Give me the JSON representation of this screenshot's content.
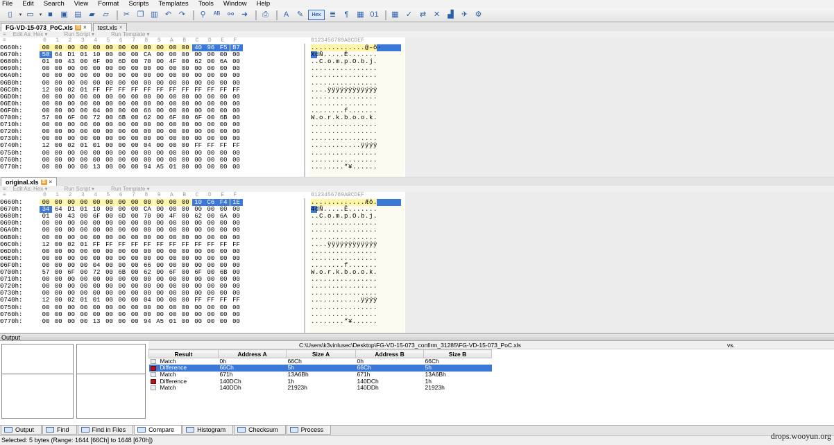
{
  "menu": [
    "File",
    "Edit",
    "Search",
    "View",
    "Format",
    "Scripts",
    "Templates",
    "Tools",
    "Window",
    "Help"
  ],
  "toolbar_icons": [
    {
      "name": "new-file-icon",
      "glyph": "▯"
    },
    {
      "name": "dropdown-icon",
      "glyph": "▾"
    },
    {
      "name": "open-file-icon",
      "glyph": "▭"
    },
    {
      "name": "dropdown-icon",
      "glyph": "▾"
    },
    {
      "name": "save-icon",
      "glyph": "■"
    },
    {
      "name": "save-as-icon",
      "glyph": "▣"
    },
    {
      "name": "save-all-icon",
      "glyph": "▤"
    },
    {
      "name": "open-folder-icon",
      "glyph": "▰"
    },
    {
      "name": "close-folder-icon",
      "glyph": "▱"
    },
    {
      "name": "sep"
    },
    {
      "name": "cut-icon",
      "glyph": "✂"
    },
    {
      "name": "copy-icon",
      "glyph": "❐"
    },
    {
      "name": "paste-icon",
      "glyph": "▥"
    },
    {
      "name": "undo-icon",
      "glyph": "↶"
    },
    {
      "name": "redo-icon",
      "glyph": "↷"
    },
    {
      "name": "sep"
    },
    {
      "name": "find-icon",
      "glyph": "⚲"
    },
    {
      "name": "replace-icon",
      "glyph": "ᴬᴮ"
    },
    {
      "name": "find-in-files-icon",
      "glyph": "⚯"
    },
    {
      "name": "goto-icon",
      "glyph": "➜"
    },
    {
      "name": "sep"
    },
    {
      "name": "print-icon",
      "glyph": "⎙"
    },
    {
      "name": "sep"
    },
    {
      "name": "font-icon",
      "glyph": "A"
    },
    {
      "name": "highlight-icon",
      "glyph": "✎"
    },
    {
      "name": "hex-view-icon",
      "glyph": "Hex",
      "hex": true
    },
    {
      "name": "text-view-icon",
      "glyph": "≣"
    },
    {
      "name": "paragraph-icon",
      "glyph": "¶"
    },
    {
      "name": "columns-icon",
      "glyph": "▦"
    },
    {
      "name": "binary-icon",
      "glyph": "01"
    },
    {
      "name": "sep"
    },
    {
      "name": "calculator-icon",
      "glyph": "▦"
    },
    {
      "name": "inspector-icon",
      "glyph": "✓"
    },
    {
      "name": "compare-icon",
      "glyph": "⇄"
    },
    {
      "name": "tools-icon",
      "glyph": "✕"
    },
    {
      "name": "histogram-icon",
      "glyph": "▟"
    },
    {
      "name": "template-icon",
      "glyph": "✈"
    },
    {
      "name": "checksum-icon",
      "glyph": "⚙"
    }
  ],
  "tabs_top": [
    {
      "label": "FG-VD-15-073_PoC.xls",
      "active": true
    },
    {
      "label": "test.xls",
      "active": false
    }
  ],
  "tabs_bottom_file": [
    {
      "label": "original.xls",
      "active": true
    }
  ],
  "subbar": {
    "edit_as": "Edit As: Hex ▾",
    "run_script": "Run Script ▾",
    "run_template": "Run Template ▾"
  },
  "hex_header": {
    "prefix": "≡",
    "cols": [
      "0",
      "1",
      "2",
      "3",
      "4",
      "5",
      "6",
      "7",
      "8",
      "9",
      "A",
      "B",
      "C",
      "D",
      "E",
      "F"
    ],
    "ascii": "0123456789ABCDEF"
  },
  "pane1": {
    "rows": [
      {
        "addr": "0660h:",
        "bytes": [
          "00",
          "00",
          "00",
          "00",
          "00",
          "00",
          "00",
          "00",
          "00",
          "00",
          "00",
          "00",
          "40",
          "96",
          "F5",
          "B7"
        ],
        "ascii": ".............@–õ·"
      },
      {
        "addr": "0670h:",
        "bytes": [
          "58",
          "64",
          "D1",
          "01",
          "10",
          "00",
          "00",
          "00",
          "CA",
          "00",
          "00",
          "00",
          "00",
          "00",
          "00",
          "00"
        ],
        "ascii": "XdÑ.....Ê......."
      },
      {
        "addr": "0680h:",
        "bytes": [
          "01",
          "00",
          "43",
          "00",
          "6F",
          "00",
          "6D",
          "00",
          "70",
          "00",
          "4F",
          "00",
          "62",
          "00",
          "6A",
          "00"
        ],
        "ascii": "..C.o.m.p.O.b.j."
      },
      {
        "addr": "0690h:",
        "bytes": [
          "00",
          "00",
          "00",
          "00",
          "00",
          "00",
          "00",
          "00",
          "00",
          "00",
          "00",
          "00",
          "00",
          "00",
          "00",
          "00"
        ],
        "ascii": "................"
      },
      {
        "addr": "06A0h:",
        "bytes": [
          "00",
          "00",
          "00",
          "00",
          "00",
          "00",
          "00",
          "00",
          "00",
          "00",
          "00",
          "00",
          "00",
          "00",
          "00",
          "00"
        ],
        "ascii": "................"
      },
      {
        "addr": "06B0h:",
        "bytes": [
          "00",
          "00",
          "00",
          "00",
          "00",
          "00",
          "00",
          "00",
          "00",
          "00",
          "00",
          "00",
          "00",
          "00",
          "00",
          "00"
        ],
        "ascii": "................"
      },
      {
        "addr": "06C0h:",
        "bytes": [
          "12",
          "00",
          "02",
          "01",
          "FF",
          "FF",
          "FF",
          "FF",
          "FF",
          "FF",
          "FF",
          "FF",
          "FF",
          "FF",
          "FF",
          "FF"
        ],
        "ascii": "....ÿÿÿÿÿÿÿÿÿÿÿÿ"
      },
      {
        "addr": "06D0h:",
        "bytes": [
          "00",
          "00",
          "00",
          "00",
          "00",
          "00",
          "00",
          "00",
          "00",
          "00",
          "00",
          "00",
          "00",
          "00",
          "00",
          "00"
        ],
        "ascii": "................"
      },
      {
        "addr": "06E0h:",
        "bytes": [
          "00",
          "00",
          "00",
          "00",
          "00",
          "00",
          "00",
          "00",
          "00",
          "00",
          "00",
          "00",
          "00",
          "00",
          "00",
          "00"
        ],
        "ascii": "................"
      },
      {
        "addr": "06F0h:",
        "bytes": [
          "00",
          "00",
          "00",
          "00",
          "04",
          "00",
          "00",
          "00",
          "66",
          "00",
          "00",
          "00",
          "00",
          "00",
          "00",
          "00"
        ],
        "ascii": "........f......."
      },
      {
        "addr": "0700h:",
        "bytes": [
          "57",
          "00",
          "6F",
          "00",
          "72",
          "00",
          "6B",
          "00",
          "62",
          "00",
          "6F",
          "00",
          "6F",
          "00",
          "6B",
          "00"
        ],
        "ascii": "W.o.r.k.b.o.o.k."
      },
      {
        "addr": "0710h:",
        "bytes": [
          "00",
          "00",
          "00",
          "00",
          "00",
          "00",
          "00",
          "00",
          "00",
          "00",
          "00",
          "00",
          "00",
          "00",
          "00",
          "00"
        ],
        "ascii": "................"
      },
      {
        "addr": "0720h:",
        "bytes": [
          "00",
          "00",
          "00",
          "00",
          "00",
          "00",
          "00",
          "00",
          "00",
          "00",
          "00",
          "00",
          "00",
          "00",
          "00",
          "00"
        ],
        "ascii": "................"
      },
      {
        "addr": "0730h:",
        "bytes": [
          "00",
          "00",
          "00",
          "00",
          "00",
          "00",
          "00",
          "00",
          "00",
          "00",
          "00",
          "00",
          "00",
          "00",
          "00",
          "00"
        ],
        "ascii": "................"
      },
      {
        "addr": "0740h:",
        "bytes": [
          "12",
          "00",
          "02",
          "01",
          "01",
          "00",
          "00",
          "00",
          "04",
          "00",
          "00",
          "00",
          "FF",
          "FF",
          "FF",
          "FF"
        ],
        "ascii": "............ÿÿÿÿ"
      },
      {
        "addr": "0750h:",
        "bytes": [
          "00",
          "00",
          "00",
          "00",
          "00",
          "00",
          "00",
          "00",
          "00",
          "00",
          "00",
          "00",
          "00",
          "00",
          "00",
          "00"
        ],
        "ascii": "................"
      },
      {
        "addr": "0760h:",
        "bytes": [
          "00",
          "00",
          "00",
          "00",
          "00",
          "00",
          "00",
          "00",
          "00",
          "00",
          "00",
          "00",
          "00",
          "00",
          "00",
          "00"
        ],
        "ascii": "................"
      },
      {
        "addr": "0770h:",
        "bytes": [
          "00",
          "00",
          "00",
          "00",
          "13",
          "00",
          "00",
          "00",
          "94",
          "A5",
          "01",
          "00",
          "00",
          "00",
          "00",
          "00"
        ],
        "ascii": "........”¥......"
      }
    ]
  },
  "pane2": {
    "rows": [
      {
        "addr": "0660h:",
        "bytes": [
          "00",
          "00",
          "00",
          "00",
          "00",
          "00",
          "00",
          "00",
          "00",
          "00",
          "00",
          "00",
          "10",
          "C6",
          "F4",
          "1E"
        ],
        "ascii": ".............Æô."
      },
      {
        "addr": "0670h:",
        "bytes": [
          "34",
          "64",
          "D1",
          "01",
          "10",
          "00",
          "00",
          "00",
          "CA",
          "00",
          "00",
          "00",
          "00",
          "00",
          "00",
          "00"
        ],
        "ascii": "4dÑ.....Ê......."
      },
      {
        "addr": "0680h:",
        "bytes": [
          "01",
          "00",
          "43",
          "00",
          "6F",
          "00",
          "6D",
          "00",
          "70",
          "00",
          "4F",
          "00",
          "62",
          "00",
          "6A",
          "00"
        ],
        "ascii": "..C.o.m.p.O.b.j."
      },
      {
        "addr": "0690h:",
        "bytes": [
          "00",
          "00",
          "00",
          "00",
          "00",
          "00",
          "00",
          "00",
          "00",
          "00",
          "00",
          "00",
          "00",
          "00",
          "00",
          "00"
        ],
        "ascii": "................"
      },
      {
        "addr": "06A0h:",
        "bytes": [
          "00",
          "00",
          "00",
          "00",
          "00",
          "00",
          "00",
          "00",
          "00",
          "00",
          "00",
          "00",
          "00",
          "00",
          "00",
          "00"
        ],
        "ascii": "................"
      },
      {
        "addr": "06B0h:",
        "bytes": [
          "00",
          "00",
          "00",
          "00",
          "00",
          "00",
          "00",
          "00",
          "00",
          "00",
          "00",
          "00",
          "00",
          "00",
          "00",
          "00"
        ],
        "ascii": "................"
      },
      {
        "addr": "06C0h:",
        "bytes": [
          "12",
          "00",
          "02",
          "01",
          "FF",
          "FF",
          "FF",
          "FF",
          "FF",
          "FF",
          "FF",
          "FF",
          "FF",
          "FF",
          "FF",
          "FF"
        ],
        "ascii": "....ÿÿÿÿÿÿÿÿÿÿÿÿ"
      },
      {
        "addr": "06D0h:",
        "bytes": [
          "00",
          "00",
          "00",
          "00",
          "00",
          "00",
          "00",
          "00",
          "00",
          "00",
          "00",
          "00",
          "00",
          "00",
          "00",
          "00"
        ],
        "ascii": "................"
      },
      {
        "addr": "06E0h:",
        "bytes": [
          "00",
          "00",
          "00",
          "00",
          "00",
          "00",
          "00",
          "00",
          "00",
          "00",
          "00",
          "00",
          "00",
          "00",
          "00",
          "00"
        ],
        "ascii": "................"
      },
      {
        "addr": "06F0h:",
        "bytes": [
          "00",
          "00",
          "00",
          "00",
          "04",
          "00",
          "00",
          "00",
          "66",
          "00",
          "00",
          "00",
          "00",
          "00",
          "00",
          "00"
        ],
        "ascii": "........f......."
      },
      {
        "addr": "0700h:",
        "bytes": [
          "57",
          "00",
          "6F",
          "00",
          "72",
          "00",
          "6B",
          "00",
          "62",
          "00",
          "6F",
          "00",
          "6F",
          "00",
          "6B",
          "00"
        ],
        "ascii": "W.o.r.k.b.o.o.k."
      },
      {
        "addr": "0710h:",
        "bytes": [
          "00",
          "00",
          "00",
          "00",
          "00",
          "00",
          "00",
          "00",
          "00",
          "00",
          "00",
          "00",
          "00",
          "00",
          "00",
          "00"
        ],
        "ascii": "................"
      },
      {
        "addr": "0720h:",
        "bytes": [
          "00",
          "00",
          "00",
          "00",
          "00",
          "00",
          "00",
          "00",
          "00",
          "00",
          "00",
          "00",
          "00",
          "00",
          "00",
          "00"
        ],
        "ascii": "................"
      },
      {
        "addr": "0730h:",
        "bytes": [
          "00",
          "00",
          "00",
          "00",
          "00",
          "00",
          "00",
          "00",
          "00",
          "00",
          "00",
          "00",
          "00",
          "00",
          "00",
          "00"
        ],
        "ascii": "................"
      },
      {
        "addr": "0740h:",
        "bytes": [
          "12",
          "00",
          "02",
          "01",
          "01",
          "00",
          "00",
          "00",
          "04",
          "00",
          "00",
          "00",
          "FF",
          "FF",
          "FF",
          "FF"
        ],
        "ascii": "............ÿÿÿÿ"
      },
      {
        "addr": "0750h:",
        "bytes": [
          "00",
          "00",
          "00",
          "00",
          "00",
          "00",
          "00",
          "00",
          "00",
          "00",
          "00",
          "00",
          "00",
          "00",
          "00",
          "00"
        ],
        "ascii": "................"
      },
      {
        "addr": "0760h:",
        "bytes": [
          "00",
          "00",
          "00",
          "00",
          "00",
          "00",
          "00",
          "00",
          "00",
          "00",
          "00",
          "00",
          "00",
          "00",
          "00",
          "00"
        ],
        "ascii": "................"
      },
      {
        "addr": "0770h:",
        "bytes": [
          "00",
          "00",
          "00",
          "00",
          "13",
          "00",
          "00",
          "00",
          "94",
          "A5",
          "01",
          "00",
          "00",
          "00",
          "00",
          "00"
        ],
        "ascii": "........”¥......"
      }
    ]
  },
  "output": {
    "title": "Output",
    "path_a": "C:\\Users\\k3vinlusec\\Desktop\\FG-VD-15-073_confirm_31285\\FG-VD-15-073_PoC.xls",
    "vs": "vs.",
    "columns": [
      "Result",
      "Address A",
      "Size A",
      "Address B",
      "Size B"
    ],
    "rows": [
      {
        "result": "Match",
        "type": "match",
        "addr_a": "0h",
        "size_a": "66Ch",
        "addr_b": "0h",
        "size_b": "66Ch"
      },
      {
        "result": "Difference",
        "type": "diff",
        "addr_a": "66Ch",
        "size_a": "5h",
        "addr_b": "66Ch",
        "size_b": "5h",
        "selected": true
      },
      {
        "result": "Match",
        "type": "match",
        "addr_a": "671h",
        "size_a": "13A6Bh",
        "addr_b": "671h",
        "size_b": "13A6Bh"
      },
      {
        "result": "Difference",
        "type": "diff",
        "addr_a": "140DCh",
        "size_a": "1h",
        "addr_b": "140DCh",
        "size_b": "1h"
      },
      {
        "result": "Match",
        "type": "match",
        "addr_a": "140DDh",
        "size_a": "21923h",
        "addr_b": "140DDh",
        "size_b": "21923h"
      }
    ]
  },
  "bottom_tabs": [
    {
      "label": "Output",
      "icon": "output-icon"
    },
    {
      "label": "Find",
      "icon": "find-icon"
    },
    {
      "label": "Find in Files",
      "icon": "find-in-files-icon"
    },
    {
      "label": "Compare",
      "icon": "compare-icon",
      "active": true
    },
    {
      "label": "Histogram",
      "icon": "histogram-icon"
    },
    {
      "label": "Checksum",
      "icon": "checksum-icon"
    },
    {
      "label": "Process",
      "icon": "process-icon"
    }
  ],
  "status": "Selected: 5 bytes (Range: 1644 [66Ch] to 1648 [670h])",
  "watermark": "drops.wooyun.org",
  "colors": {
    "selection": "#3c78d8",
    "highlight": "#fff5a8",
    "difference": "#b01818"
  }
}
